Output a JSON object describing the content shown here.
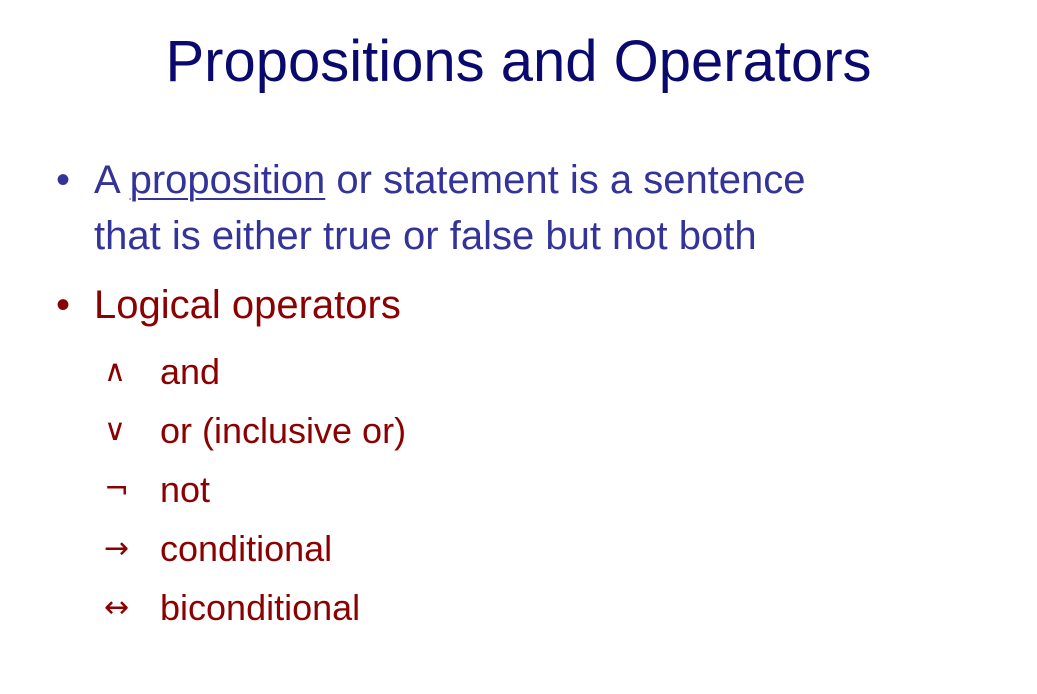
{
  "slide": {
    "title": "Propositions and Operators",
    "bullets": [
      {
        "marker": "•",
        "prefix": "A ",
        "underlined": "proposition",
        "rest_line1": " or statement is a sentence",
        "line2": "that is either true or false but not both"
      },
      {
        "marker": "•",
        "text": "Logical operators"
      }
    ],
    "operators": [
      {
        "symbol": "∧",
        "symbol_name": "and-symbol",
        "label": "and"
      },
      {
        "symbol": "∨",
        "symbol_name": "or-symbol",
        "label": "or (inclusive or)"
      },
      {
        "symbol": "¬",
        "symbol_name": "not-symbol",
        "label": "not"
      },
      {
        "symbol": "→",
        "symbol_name": "right-arrow-symbol",
        "label": "conditional"
      },
      {
        "symbol": "↔",
        "symbol_name": "double-arrow-symbol",
        "label": "biconditional"
      }
    ]
  },
  "colors": {
    "title": "#0a0a6e",
    "bullet1": "#33339a",
    "bullet2": "#8b0000"
  }
}
